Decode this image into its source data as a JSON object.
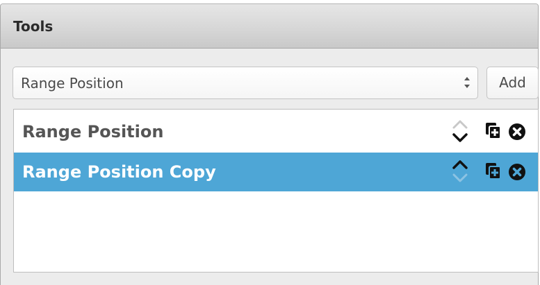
{
  "panel": {
    "title": "Tools"
  },
  "tool_select": {
    "selected": "Range Position"
  },
  "add_button": {
    "label": "Add"
  },
  "tools": [
    {
      "label": "Range Position",
      "selected": false
    },
    {
      "label": "Range Position Copy",
      "selected": true
    }
  ],
  "icons": {
    "move": "chevron-up-down-icon",
    "duplicate": "duplicate-icon",
    "delete": "remove-circle-icon",
    "select_arrows": "select-arrows-icon"
  },
  "colors": {
    "selected_row": "#4ea6d6",
    "header_bg": "#d7d7d7"
  }
}
